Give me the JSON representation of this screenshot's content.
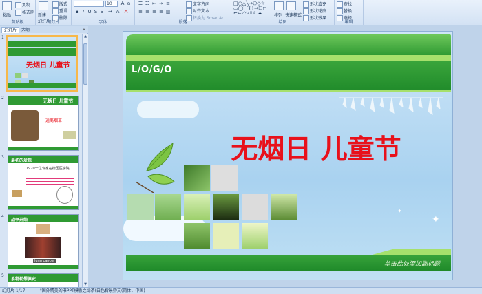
{
  "ribbon": {
    "clipboard": {
      "label": "剪贴板",
      "paste": "粘贴",
      "copy": "复制",
      "format_painter": "格式刷"
    },
    "slides": {
      "label": "幻灯片",
      "new_slide": "新建\n幻灯片",
      "layout": "版式",
      "reset": "重设",
      "delete": "删除"
    },
    "font": {
      "label": "字体",
      "size": "10"
    },
    "paragraph": {
      "label": "段落",
      "text_direction": "文字方向",
      "align_text": "对齐文本",
      "smartart": "转换为 SmartArt"
    },
    "drawing": {
      "label": "绘图",
      "arrange": "排列",
      "quick_styles": "快速样式",
      "shape_fill": "形状填充",
      "shape_outline": "形状轮廓",
      "shape_effects": "形状效果"
    },
    "editing": {
      "label": "编辑",
      "find": "查找",
      "replace": "替换",
      "select": "选择"
    }
  },
  "left_pane": {
    "tab_slides": "幻灯片",
    "tab_outline": "大纲",
    "close": "×",
    "thumbnails": [
      {
        "num": "1",
        "title": "无烟日 儿童节",
        "selected": true
      },
      {
        "num": "2",
        "title": "无烟日 儿童节",
        "caption": "远离烟草",
        "selected": false
      },
      {
        "num": "3",
        "title": "最初的发现",
        "body": "1920一位专家在德国医学院…",
        "selected": false
      },
      {
        "num": "4",
        "title": "战争开始",
        "caption": "lung cancer",
        "selected": false
      },
      {
        "num": "5",
        "title": "系特勒想佩史",
        "selected": false
      }
    ]
  },
  "slide": {
    "logo": "L/O/G/O",
    "title": "无烟日 儿童节",
    "subtitle": "单击此处添加副标题"
  },
  "status": {
    "slide_info": "幻灯片 1/17",
    "theme": "\"国外精美的书PPT模板之绿茶(白色背景)\"",
    "language": "中文(简体，中国)"
  },
  "colors": {
    "accent_green": "#2f9a33",
    "title_red": "#e8111b",
    "ribbon_bg": "#dbe7f6"
  }
}
